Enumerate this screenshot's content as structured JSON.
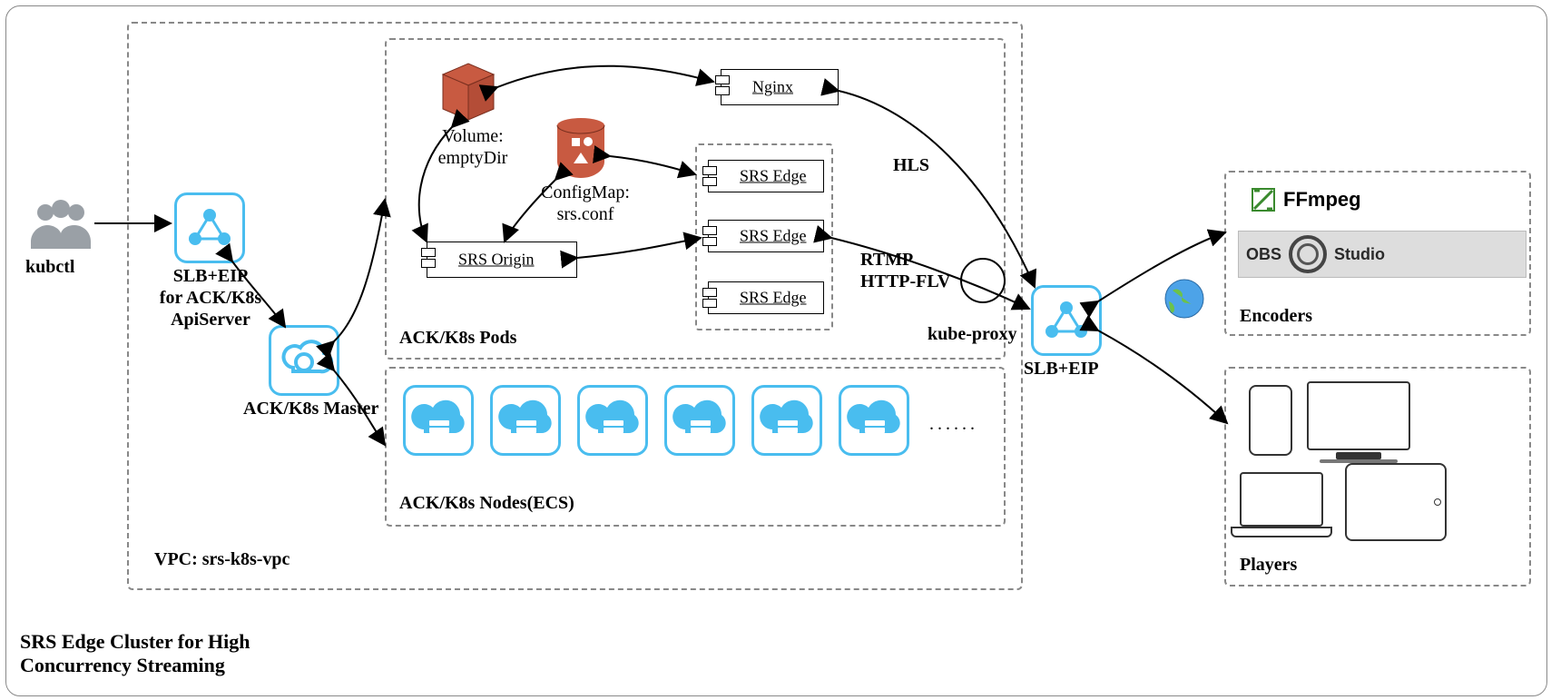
{
  "title": "SRS Edge Cluster for High Concurrency Streaming",
  "kubectl_label": "kubctl",
  "slb_apiserver_label": "SLB+EIP\nfor ACK/K8s\nApiServer",
  "master_label": "ACK/K8s Master",
  "vpc_label": "VPC: srs-k8s-vpc",
  "pods_label": "ACK/K8s Pods",
  "nodes_label": "ACK/K8s Nodes(ECS)",
  "nodes_ellipsis": "......",
  "volume_label": "Volume:\nemptyDir",
  "configmap_label": "ConfigMap:\nsrs.conf",
  "components": {
    "nginx": "Nginx",
    "srs_origin": "SRS Origin",
    "srs_edge": "SRS Edge"
  },
  "hls_label": "HLS",
  "rtmp_flv_label": "RTMP\nHTTP-FLV",
  "kube_proxy_label": "kube-proxy",
  "slb_eip_label": "SLB+EIP",
  "encoders_label": "Encoders",
  "players_label": "Players",
  "ffmpeg_label": "FFmpeg",
  "obs_label_1": "OBS",
  "obs_label_2": "Studio",
  "colors": {
    "accent": "#49bdef",
    "volume_red": "#c85a41",
    "ffmpeg_green": "#3a8a2e"
  }
}
